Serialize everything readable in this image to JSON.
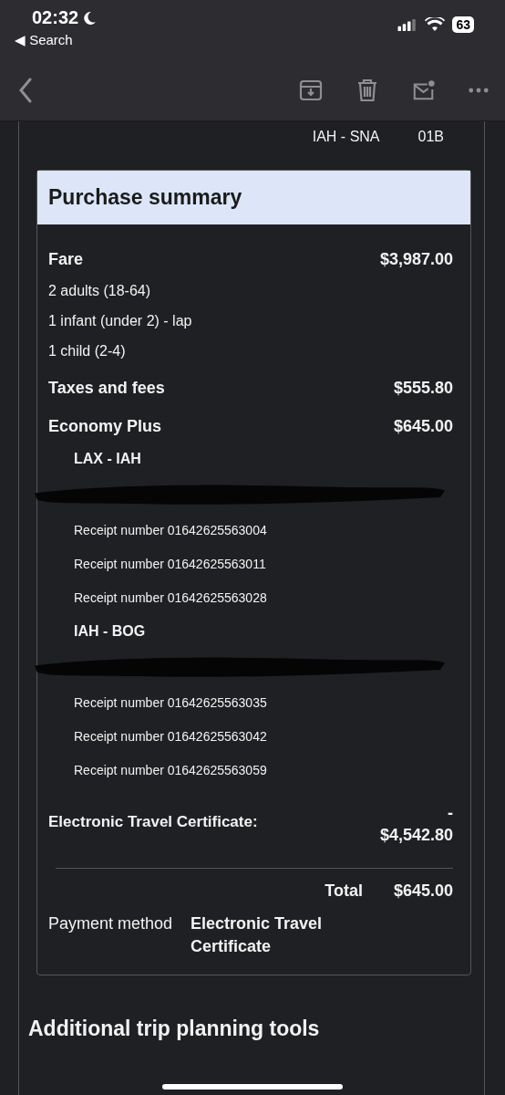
{
  "status_bar": {
    "time": "02:32",
    "back_app": "◀ Search",
    "battery": "63"
  },
  "flight_row": {
    "route": "IAH - SNA",
    "seat": "01B"
  },
  "summary": {
    "title": "Purchase summary",
    "lines": [
      {
        "kind": "main",
        "label": "Fare",
        "amount": "$3,987.00"
      },
      {
        "kind": "sub",
        "label": "2 adults (18-64)"
      },
      {
        "kind": "sub",
        "label": "1 infant (under 2) - lap"
      },
      {
        "kind": "sub",
        "label": "1 child (2-4)"
      },
      {
        "kind": "main",
        "label": "Taxes and fees",
        "amount": "$555.80"
      },
      {
        "kind": "main",
        "label": "Economy Plus",
        "amount": "$645.00"
      },
      {
        "kind": "segment",
        "label": "LAX - IAH"
      },
      {
        "kind": "redacted"
      },
      {
        "kind": "receipt",
        "label": "Receipt number 01642625563004"
      },
      {
        "kind": "receipt",
        "label": "Receipt number 01642625563011"
      },
      {
        "kind": "receipt",
        "label": "Receipt number 01642625563028"
      },
      {
        "kind": "segment",
        "label": "IAH - BOG"
      },
      {
        "kind": "redacted"
      },
      {
        "kind": "receipt",
        "label": "Receipt number 01642625563035"
      },
      {
        "kind": "receipt",
        "label": "Receipt number 01642625563042"
      },
      {
        "kind": "receipt",
        "label": "Receipt number 01642625563059"
      }
    ],
    "certificate": {
      "label": "Electronic Travel Certificate:",
      "sign": "-",
      "amount": "$4,542.80"
    },
    "total": {
      "label": "Total",
      "amount": "$645.00"
    },
    "payment": {
      "label": "Payment method",
      "value": "Electronic Travel Certificate"
    }
  },
  "next_heading": "Additional trip planning tools"
}
